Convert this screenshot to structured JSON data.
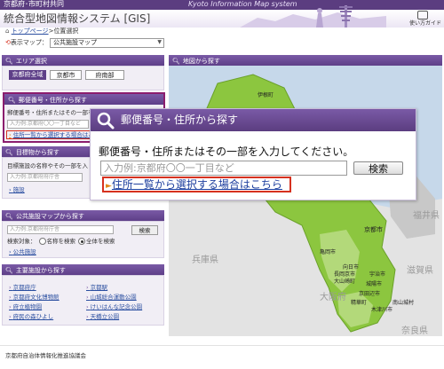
{
  "header": {
    "org": "京都府･市町村共同",
    "english": "Kyoto Information Map system",
    "title": "統合型地図情報システム [GIS]",
    "guide_label": "使い方ガイド"
  },
  "breadcrumb": {
    "home": "トップページ",
    "separator": ">",
    "current": "位置選択"
  },
  "map_select": {
    "label": "表示マップ：",
    "value": "公共施設マップ"
  },
  "area_panel": {
    "title": "エリア選択",
    "buttons": [
      "京都府全域",
      "京都市",
      "府南部"
    ]
  },
  "postal_panel": {
    "title": "郵便番号・住所から探す",
    "description": "郵便番号・住所またはその一部を",
    "placeholder": "入力例:京都府〇〇一丁目など",
    "link": "住所一覧から選択する場合はこちら"
  },
  "facility_panel": {
    "title": "目標物から探す",
    "description": "目標施設の名称やその一部を入",
    "placeholder": "入力例:京都府府庁舎",
    "link": "施設"
  },
  "public_panel": {
    "title": "公共施設マップから探す",
    "placeholder": "入力例:京都府府庁舎",
    "button": "検索",
    "target_label": "検索対象：",
    "option_name": "名称を検索",
    "option_all": "全体を検索",
    "link": "公共施設"
  },
  "main_panel": {
    "title": "主要施設から探す",
    "links": [
      "京都府庁",
      "京都駅",
      "京都府文化博物館",
      "山城総合運動公園",
      "府立植物園",
      "けいはんな記念公園",
      "府民の森ひよし",
      "天橋立公園"
    ]
  },
  "map_panel": {
    "title": "地図から探す"
  },
  "map_labels": {
    "prefs": [
      "兵庫県",
      "大阪府",
      "滋賀県",
      "奈良県",
      "福井県"
    ],
    "cities": [
      "伊根町",
      "京都市",
      "亀岡市",
      "向日市",
      "長岡京市",
      "大山崎町",
      "宇治市",
      "城陽市",
      "京田辺市",
      "木津川市",
      "精華町",
      "南山城村"
    ]
  },
  "zoom": {
    "title": "郵便番号・住所から探す",
    "description": "郵便番号・住所またはその一部を入力してください。",
    "placeholder": "入力例:京都府〇〇一丁目など",
    "button": "検索",
    "arrow": "►",
    "link": "住所一覧から選択する場合はこちら"
  },
  "footer": {
    "text": "京都府自治体情報化推進協議会"
  },
  "colors": {
    "purple": "#5e3f88",
    "highlight": "#d6311f",
    "map_green": "#8cc63f",
    "link": "#2a4ea0"
  }
}
